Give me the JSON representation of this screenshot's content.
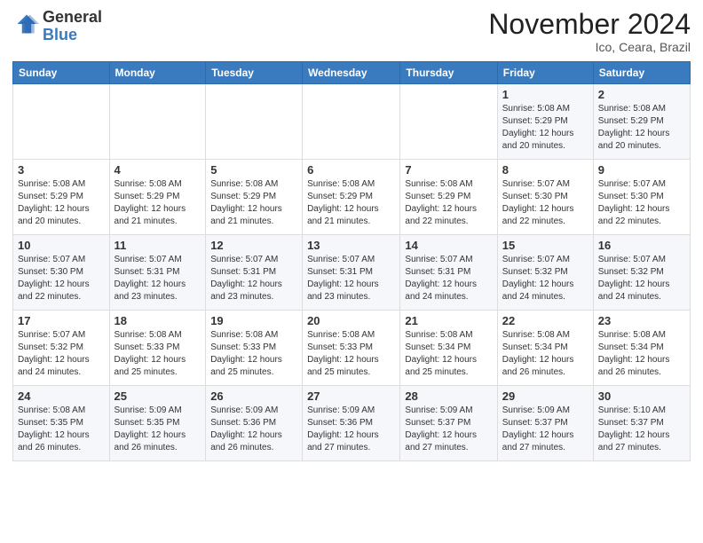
{
  "logo": {
    "general": "General",
    "blue": "Blue"
  },
  "header": {
    "month": "November 2024",
    "location": "Ico, Ceara, Brazil"
  },
  "weekdays": [
    "Sunday",
    "Monday",
    "Tuesday",
    "Wednesday",
    "Thursday",
    "Friday",
    "Saturday"
  ],
  "weeks": [
    [
      {
        "day": "",
        "info": ""
      },
      {
        "day": "",
        "info": ""
      },
      {
        "day": "",
        "info": ""
      },
      {
        "day": "",
        "info": ""
      },
      {
        "day": "",
        "info": ""
      },
      {
        "day": "1",
        "info": "Sunrise: 5:08 AM\nSunset: 5:29 PM\nDaylight: 12 hours\nand 20 minutes."
      },
      {
        "day": "2",
        "info": "Sunrise: 5:08 AM\nSunset: 5:29 PM\nDaylight: 12 hours\nand 20 minutes."
      }
    ],
    [
      {
        "day": "3",
        "info": "Sunrise: 5:08 AM\nSunset: 5:29 PM\nDaylight: 12 hours\nand 20 minutes."
      },
      {
        "day": "4",
        "info": "Sunrise: 5:08 AM\nSunset: 5:29 PM\nDaylight: 12 hours\nand 21 minutes."
      },
      {
        "day": "5",
        "info": "Sunrise: 5:08 AM\nSunset: 5:29 PM\nDaylight: 12 hours\nand 21 minutes."
      },
      {
        "day": "6",
        "info": "Sunrise: 5:08 AM\nSunset: 5:29 PM\nDaylight: 12 hours\nand 21 minutes."
      },
      {
        "day": "7",
        "info": "Sunrise: 5:08 AM\nSunset: 5:29 PM\nDaylight: 12 hours\nand 22 minutes."
      },
      {
        "day": "8",
        "info": "Sunrise: 5:07 AM\nSunset: 5:30 PM\nDaylight: 12 hours\nand 22 minutes."
      },
      {
        "day": "9",
        "info": "Sunrise: 5:07 AM\nSunset: 5:30 PM\nDaylight: 12 hours\nand 22 minutes."
      }
    ],
    [
      {
        "day": "10",
        "info": "Sunrise: 5:07 AM\nSunset: 5:30 PM\nDaylight: 12 hours\nand 22 minutes."
      },
      {
        "day": "11",
        "info": "Sunrise: 5:07 AM\nSunset: 5:31 PM\nDaylight: 12 hours\nand 23 minutes."
      },
      {
        "day": "12",
        "info": "Sunrise: 5:07 AM\nSunset: 5:31 PM\nDaylight: 12 hours\nand 23 minutes."
      },
      {
        "day": "13",
        "info": "Sunrise: 5:07 AM\nSunset: 5:31 PM\nDaylight: 12 hours\nand 23 minutes."
      },
      {
        "day": "14",
        "info": "Sunrise: 5:07 AM\nSunset: 5:31 PM\nDaylight: 12 hours\nand 24 minutes."
      },
      {
        "day": "15",
        "info": "Sunrise: 5:07 AM\nSunset: 5:32 PM\nDaylight: 12 hours\nand 24 minutes."
      },
      {
        "day": "16",
        "info": "Sunrise: 5:07 AM\nSunset: 5:32 PM\nDaylight: 12 hours\nand 24 minutes."
      }
    ],
    [
      {
        "day": "17",
        "info": "Sunrise: 5:07 AM\nSunset: 5:32 PM\nDaylight: 12 hours\nand 24 minutes."
      },
      {
        "day": "18",
        "info": "Sunrise: 5:08 AM\nSunset: 5:33 PM\nDaylight: 12 hours\nand 25 minutes."
      },
      {
        "day": "19",
        "info": "Sunrise: 5:08 AM\nSunset: 5:33 PM\nDaylight: 12 hours\nand 25 minutes."
      },
      {
        "day": "20",
        "info": "Sunrise: 5:08 AM\nSunset: 5:33 PM\nDaylight: 12 hours\nand 25 minutes."
      },
      {
        "day": "21",
        "info": "Sunrise: 5:08 AM\nSunset: 5:34 PM\nDaylight: 12 hours\nand 25 minutes."
      },
      {
        "day": "22",
        "info": "Sunrise: 5:08 AM\nSunset: 5:34 PM\nDaylight: 12 hours\nand 26 minutes."
      },
      {
        "day": "23",
        "info": "Sunrise: 5:08 AM\nSunset: 5:34 PM\nDaylight: 12 hours\nand 26 minutes."
      }
    ],
    [
      {
        "day": "24",
        "info": "Sunrise: 5:08 AM\nSunset: 5:35 PM\nDaylight: 12 hours\nand 26 minutes."
      },
      {
        "day": "25",
        "info": "Sunrise: 5:09 AM\nSunset: 5:35 PM\nDaylight: 12 hours\nand 26 minutes."
      },
      {
        "day": "26",
        "info": "Sunrise: 5:09 AM\nSunset: 5:36 PM\nDaylight: 12 hours\nand 26 minutes."
      },
      {
        "day": "27",
        "info": "Sunrise: 5:09 AM\nSunset: 5:36 PM\nDaylight: 12 hours\nand 27 minutes."
      },
      {
        "day": "28",
        "info": "Sunrise: 5:09 AM\nSunset: 5:37 PM\nDaylight: 12 hours\nand 27 minutes."
      },
      {
        "day": "29",
        "info": "Sunrise: 5:09 AM\nSunset: 5:37 PM\nDaylight: 12 hours\nand 27 minutes."
      },
      {
        "day": "30",
        "info": "Sunrise: 5:10 AM\nSunset: 5:37 PM\nDaylight: 12 hours\nand 27 minutes."
      }
    ]
  ]
}
